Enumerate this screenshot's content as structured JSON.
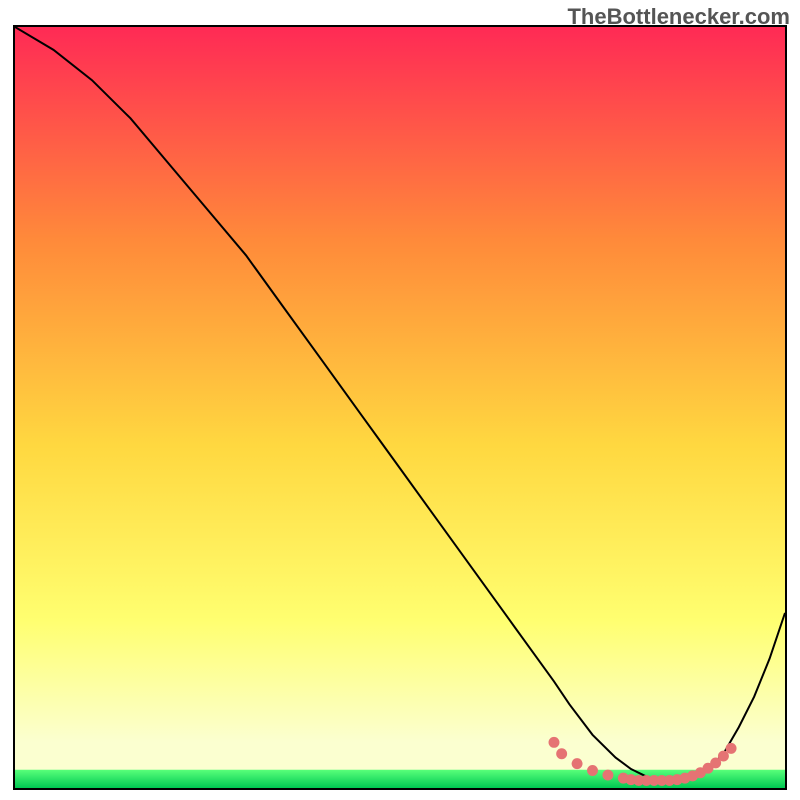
{
  "watermark": "TheBottlenecker.com",
  "colors": {
    "grad_top": "#ff2a55",
    "grad_mid1": "#ff8a3a",
    "grad_mid2": "#ffd840",
    "grad_mid3": "#ffff70",
    "grad_bottom": "#fbffd0",
    "green_dark": "#00c853",
    "green_light": "#59ff7a",
    "curve": "#000000",
    "dots": "#e57373"
  },
  "chart_data": {
    "type": "line",
    "title": "",
    "xlabel": "",
    "ylabel": "",
    "xlim": [
      0,
      100
    ],
    "ylim": [
      0,
      100
    ],
    "series": [
      {
        "name": "bottleneck-curve",
        "x": [
          0,
          5,
          10,
          15,
          20,
          25,
          30,
          35,
          40,
          45,
          50,
          55,
          60,
          65,
          70,
          72,
          75,
          78,
          80,
          82,
          84,
          86,
          88,
          90,
          92,
          94,
          96,
          98,
          100
        ],
        "y": [
          100,
          97,
          93,
          88,
          82,
          76,
          70,
          63,
          56,
          49,
          42,
          35,
          28,
          21,
          14,
          11,
          7,
          4,
          2.5,
          1.5,
          1,
          1,
          1.5,
          2.5,
          4.5,
          8,
          12,
          17,
          23
        ]
      }
    ],
    "scatter": {
      "name": "optimal-range-dots",
      "x": [
        70,
        71,
        73,
        75,
        77,
        79,
        80,
        81,
        82,
        83,
        84,
        85,
        86,
        87,
        88,
        89,
        90,
        91,
        92,
        93
      ],
      "y": [
        6,
        4.5,
        3.2,
        2.3,
        1.7,
        1.3,
        1.1,
        1.0,
        1.0,
        1.0,
        1.0,
        1.0,
        1.1,
        1.3,
        1.6,
        2.0,
        2.6,
        3.3,
        4.2,
        5.2
      ]
    },
    "green_band_y": [
      0,
      2.4
    ]
  }
}
